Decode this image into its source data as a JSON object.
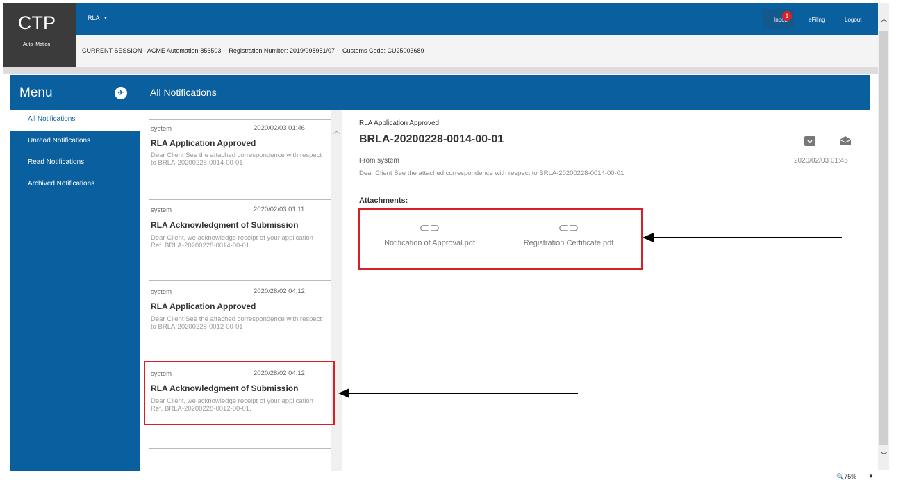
{
  "brand": {
    "name": "CTP",
    "user": "Auto_Mation"
  },
  "topnav": {
    "module": "RLA",
    "inbox_label": "Inbox",
    "inbox_count": "1",
    "efiling": "eFiling",
    "logout": "Logout"
  },
  "session": {
    "text": "CURRENT SESSION - ACME Automation-856503 -- Registration Number: 2019/998951/07 -- Customs Code: CU25003689"
  },
  "sidebar": {
    "title": "Menu",
    "items": [
      {
        "label": "All Notifications"
      },
      {
        "label": "Unread Notifications"
      },
      {
        "label": "Read Notifications"
      },
      {
        "label": "Archived Notifications"
      }
    ]
  },
  "page": {
    "title": "All Notifications"
  },
  "notifications": [
    {
      "sender": "system",
      "date": "2020/02/03 01:46",
      "title": "RLA Application Approved",
      "preview": "Dear Client See the attached correspondence with respect to BRLA-20200228-0014-00-01"
    },
    {
      "sender": "system",
      "date": "2020/02/03 01:11",
      "title": "RLA Acknowledgment of Submission",
      "preview": "Dear Client, we acknowledge receipt of your application Ref. BRLA-20200228-0014-00-01."
    },
    {
      "sender": "system",
      "date": "2020/28/02 04:12",
      "title": "RLA Application Approved",
      "preview": "Dear Client See the attached correspondence with respect to BRLA-20200228-0012-00-01"
    },
    {
      "sender": "system",
      "date": "2020/28/02 04:12",
      "title": "RLA Acknowledgment of Submission",
      "preview": "Dear Client, we acknowledge receipt of your application Ref. BRLA-20200228-0012-00-01."
    }
  ],
  "detail": {
    "subject": "RLA Application Approved",
    "reference": "BRLA-20200228-0014-00-01",
    "from": "From system",
    "date": "2020/02/03 01:46",
    "body": "Dear Client See the attached correspondence with respect to BRLA-20200228-0014-00-01",
    "attachments_label": "Attachments:",
    "attachments": [
      {
        "name": "Notification of Approval.pdf"
      },
      {
        "name": "Registration Certificate.pdf"
      }
    ]
  },
  "statusbar": {
    "zoom": "75%"
  },
  "colors": {
    "primary": "#0a5f9e",
    "highlight": "#d81f26",
    "badge": "#e02020"
  }
}
